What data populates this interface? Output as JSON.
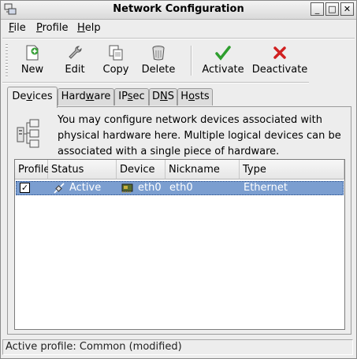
{
  "window": {
    "title": "Network Configuration",
    "controls": {
      "minimize": "_",
      "maximize": "□",
      "close": "✕"
    }
  },
  "menu": {
    "file": {
      "label": "File",
      "mnemonic": "F",
      "rest": "ile"
    },
    "profile": {
      "label": "Profile",
      "mnemonic": "P",
      "rest": "rofile"
    },
    "help": {
      "label": "Help",
      "mnemonic": "H",
      "rest": "elp"
    }
  },
  "toolbar": {
    "new": "New",
    "edit": "Edit",
    "copy": "Copy",
    "delete": "Delete",
    "activate": "Activate",
    "deactivate": "Deactivate"
  },
  "tabs": {
    "devices": {
      "label": "Devices",
      "pre": "De",
      "mn": "v",
      "post": "ices"
    },
    "hardware": {
      "label": "Hardware",
      "pre": "Hard",
      "mn": "w",
      "post": "are"
    },
    "ipsec": {
      "label": "IPsec",
      "pre": "IP",
      "mn": "s",
      "post": "ec"
    },
    "dns": {
      "label": "DNS",
      "pre": "D",
      "mn": "N",
      "post": "S"
    },
    "hosts": {
      "label": "Hosts",
      "pre": "H",
      "mn": "o",
      "post": "sts"
    }
  },
  "devices_panel": {
    "description": "You may configure network devices associated with physical hardware here.  Multiple logical devices can be associated with a single piece of hardware.",
    "columns": [
      "Profile",
      "Status",
      "Device",
      "Nickname",
      "Type"
    ],
    "rows": [
      {
        "profile_checked": true,
        "status": "Active",
        "device": "eth0",
        "nickname": "eth0",
        "type": "Ethernet"
      }
    ]
  },
  "statusbar": {
    "text": "Active profile: Common (modified)"
  },
  "colors": {
    "selection": "#7b9ed0",
    "window_bg": "#ededed",
    "activate_green": "#2e9e2e",
    "deactivate_red": "#d02020"
  }
}
